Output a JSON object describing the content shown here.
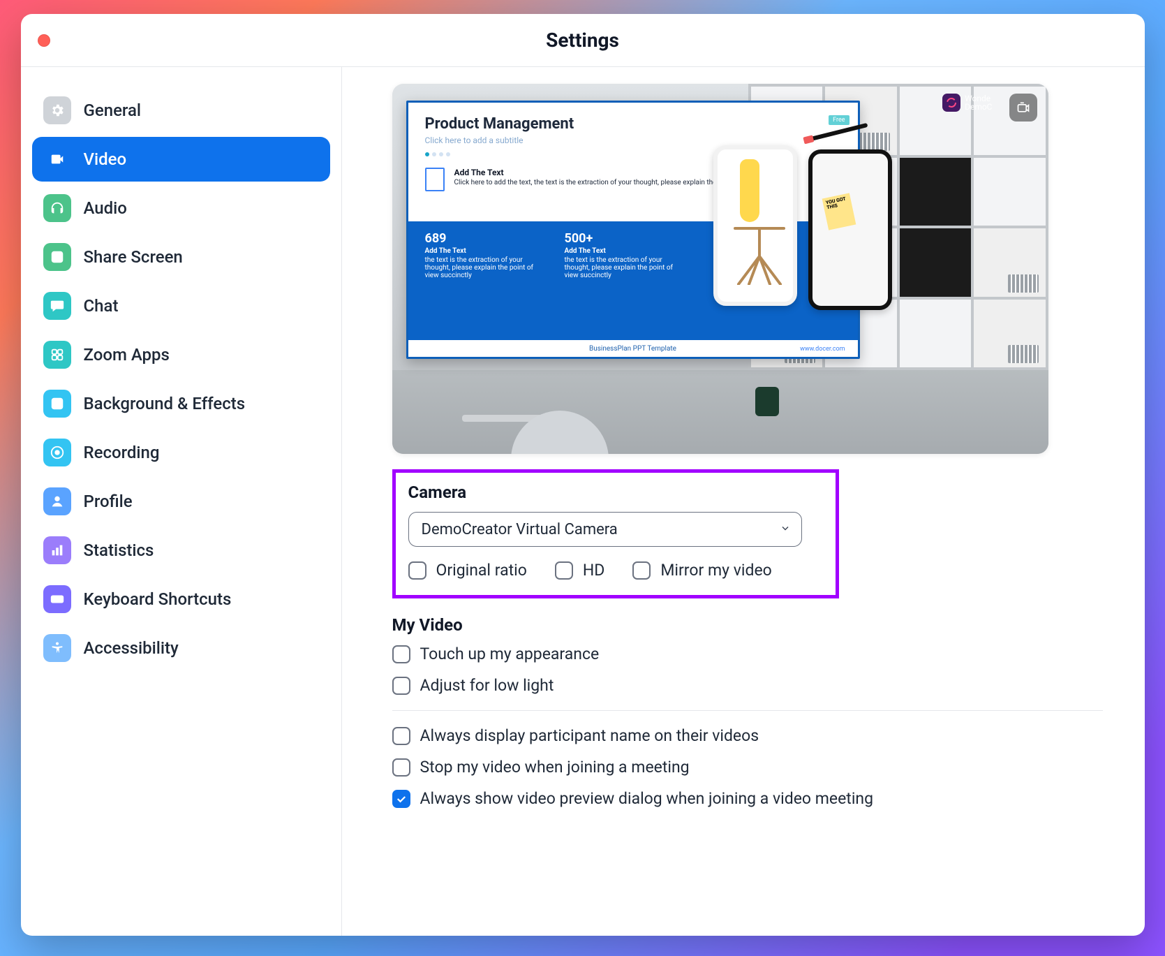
{
  "window": {
    "title": "Settings"
  },
  "sidebar": {
    "items": [
      {
        "id": "general",
        "label": "General"
      },
      {
        "id": "video",
        "label": "Video"
      },
      {
        "id": "audio",
        "label": "Audio"
      },
      {
        "id": "share-screen",
        "label": "Share Screen"
      },
      {
        "id": "chat",
        "label": "Chat"
      },
      {
        "id": "zoom-apps",
        "label": "Zoom Apps"
      },
      {
        "id": "background-effects",
        "label": "Background & Effects"
      },
      {
        "id": "recording",
        "label": "Recording"
      },
      {
        "id": "profile",
        "label": "Profile"
      },
      {
        "id": "statistics",
        "label": "Statistics"
      },
      {
        "id": "keyboard-shortcuts",
        "label": "Keyboard Shortcuts"
      },
      {
        "id": "accessibility",
        "label": "Accessibility"
      }
    ],
    "active": "video"
  },
  "preview": {
    "slide": {
      "title": "Product Management",
      "subtitle": "Click here to add a subtitle",
      "add_text_heading": "Add The Text",
      "add_text_body": "Click here to add the text, the text is the extraction of your thought, please explain the point of view succinctly",
      "stats": [
        {
          "num": "689",
          "label": "Add The Text",
          "desc": "the text is the extraction of your thought, please explain the point of view succinctly"
        },
        {
          "num": "500+",
          "label": "Add The Text",
          "desc": "the text is the extraction of your thought, please explain the point of view succinctly"
        }
      ],
      "footer": "BusinessPlan PPT Template",
      "link": "www.docer.com",
      "tag": "Free",
      "note_text": "YOU GOT THIS"
    },
    "badge": {
      "brand1": "Wonde",
      "brand2": "DemoC"
    }
  },
  "camera": {
    "section_title": "Camera",
    "selected": "DemoCreator Virtual Camera",
    "options": {
      "original_ratio": {
        "label": "Original ratio",
        "checked": false
      },
      "hd": {
        "label": "HD",
        "checked": false
      },
      "mirror": {
        "label": "Mirror my video",
        "checked": false
      }
    }
  },
  "my_video": {
    "section_title": "My Video",
    "touch_up": {
      "label": "Touch up my appearance",
      "checked": false
    },
    "low_light": {
      "label": "Adjust for low light",
      "checked": false
    },
    "display_name": {
      "label": "Always display participant name on their videos",
      "checked": false
    },
    "stop_on_join": {
      "label": "Stop my video when joining a meeting",
      "checked": false
    },
    "show_preview": {
      "label": "Always show video preview dialog when joining a video meeting",
      "checked": true
    }
  }
}
